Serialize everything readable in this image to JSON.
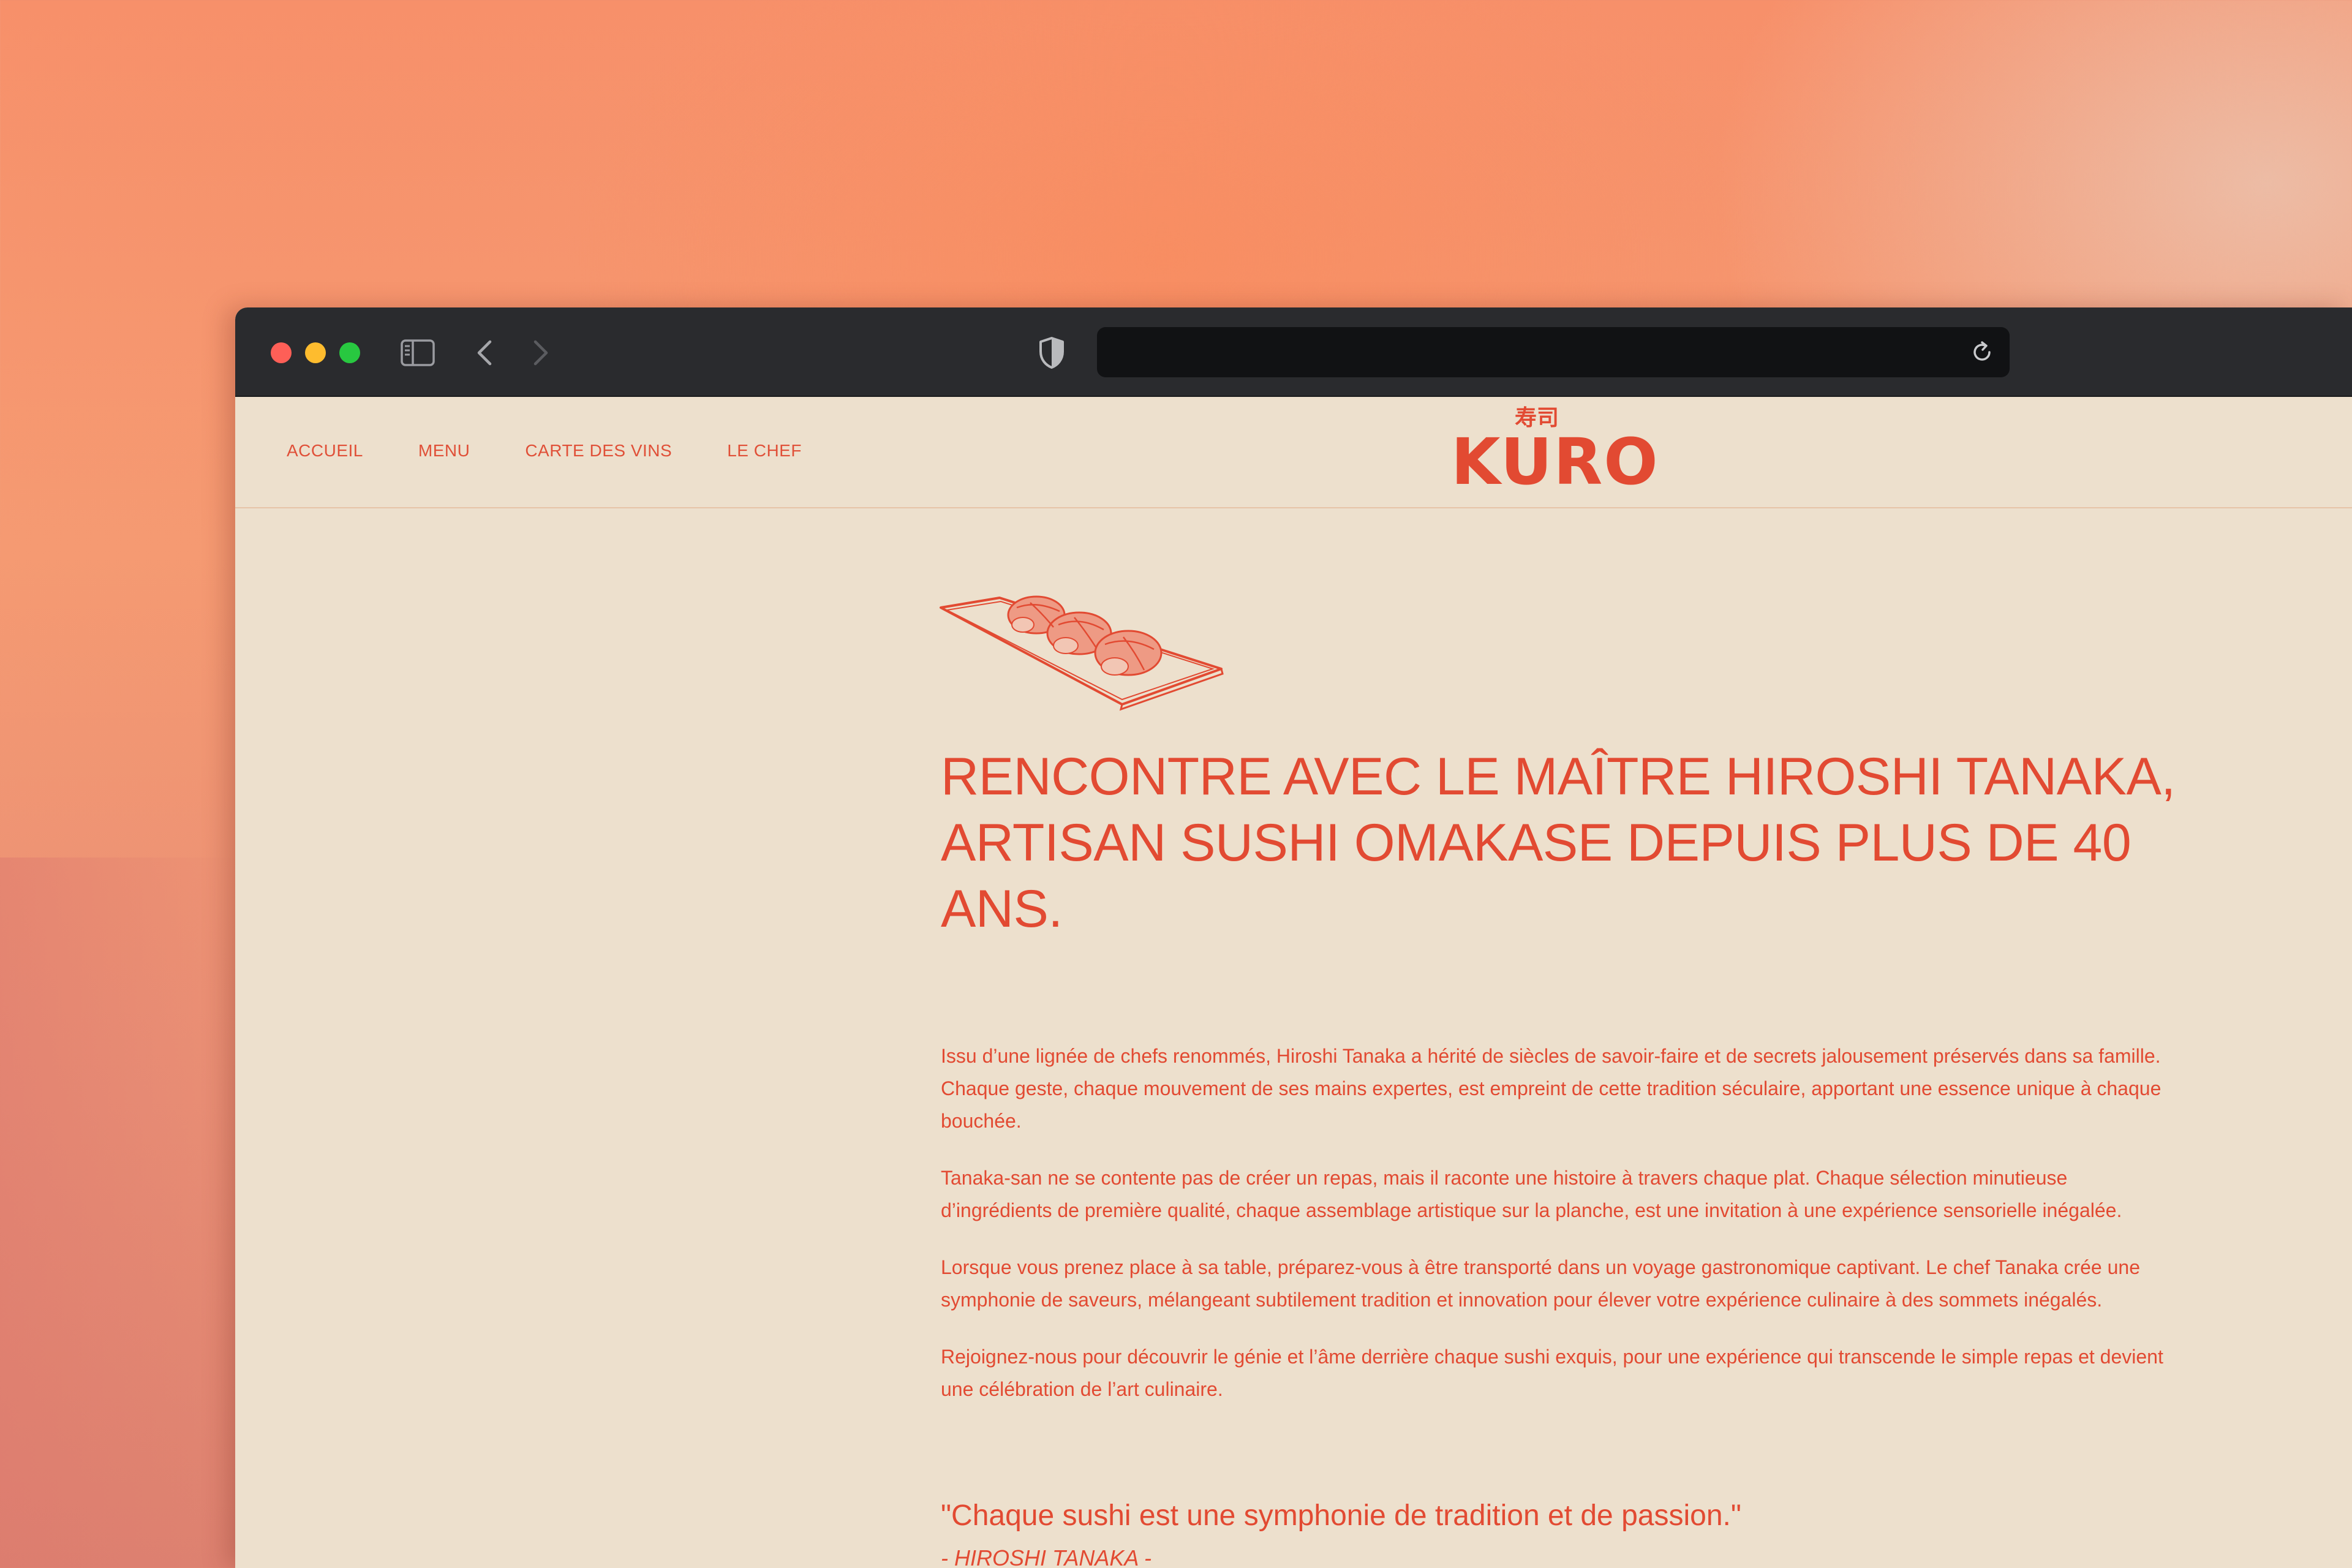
{
  "browser": {
    "url_text": ""
  },
  "nav": {
    "items": [
      "ACCUEIL",
      "MENU",
      "CARTE DES VINS",
      "LE CHEF"
    ]
  },
  "logo": {
    "kanji": "寿司",
    "word": "KURO"
  },
  "article": {
    "headline_line1": "RENCONTRE AVEC LE MAÎTRE HIROSHI TANAKA,",
    "headline_line2": "ARTISAN SUSHI OMAKASE DEPUIS PLUS DE 40 ANS.",
    "paragraphs": [
      "Issu d’une lignée de chefs renommés, Hiroshi Tanaka a hérité de siècles de savoir-faire et de secrets jalousement préservés dans sa famille. Chaque geste, chaque mouvement de ses mains expertes, est empreint de cette tradition séculaire, apportant une essence unique à chaque bouchée.",
      "Tanaka-san ne se contente pas de créer un repas, mais il raconte une histoire à travers chaque plat. Chaque sélection minutieuse d’ingrédients de première qualité, chaque assemblage artistique sur la planche, est une invitation à une expérience sensorielle inégalée.",
      "Lorsque vous prenez place à sa table, préparez-vous à être transporté dans un voyage gastronomique captivant. Le chef Tanaka crée une symphonie de saveurs, mélangeant subtilement tradition et innovation pour élever votre expérience culinaire à des sommets inégalés.",
      "Rejoignez-nous pour découvrir le génie et l’âme derrière chaque sushi exquis, pour une expérience qui transcende le simple repas et devient une célébration de l’art culinaire."
    ],
    "quote": "\"Chaque sushi est une symphonie de tradition et de passion.\"",
    "quote_author": "- HIROSHI TANAKA -"
  },
  "colors": {
    "accent": "#e24a32",
    "page_background": "#ede0cd",
    "titlebar": "#2a2b2e"
  },
  "icons": [
    "sidebar-toggle-icon",
    "back-arrow-icon",
    "forward-arrow-icon",
    "privacy-shield-icon",
    "reload-icon",
    "sushi-plate-illustration"
  ]
}
